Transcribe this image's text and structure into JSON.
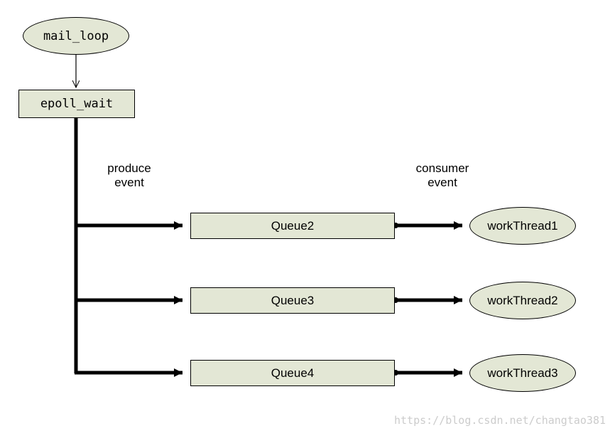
{
  "nodes": {
    "mail_loop": "mail_loop",
    "epoll_wait": "epoll_wait",
    "queue2": "Queue2",
    "queue3": "Queue3",
    "queue4": "Queue4",
    "worker1": "workThread1",
    "worker2": "workThread2",
    "worker3": "workThread3"
  },
  "labels": {
    "produce_event_l1": "produce",
    "produce_event_l2": "event",
    "consumer_event_l1": "consumer",
    "consumer_event_l2": "event"
  },
  "watermark": "https://blog.csdn.net/changtao381"
}
